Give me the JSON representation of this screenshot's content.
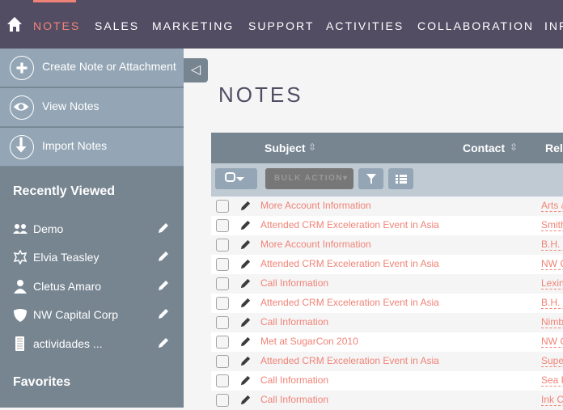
{
  "nav": {
    "tabs": [
      "NOTES",
      "SALES",
      "MARKETING",
      "SUPPORT",
      "ACTIVITIES",
      "COLLABORATION",
      "INF"
    ],
    "active": "NOTES"
  },
  "sidebar": {
    "actions": [
      {
        "label": "Create Note or Attachment",
        "icon": "plus-circle-icon"
      },
      {
        "label": "View Notes",
        "icon": "eye-icon"
      },
      {
        "label": "Import Notes",
        "icon": "download-arrow-icon"
      }
    ],
    "recently_viewed_title": "Recently Viewed",
    "recently_viewed": [
      {
        "label": "Demo",
        "icon": "users-icon"
      },
      {
        "label": "Elvia Teasley",
        "icon": "target-star-icon"
      },
      {
        "label": "Cletus Amaro",
        "icon": "user-icon"
      },
      {
        "label": "NW Capital Corp",
        "icon": "shield-icon"
      },
      {
        "label": "actividades ...",
        "icon": "document-icon"
      }
    ],
    "favorites_title": "Favorites"
  },
  "toggle": "◁",
  "page_title": "NOTES",
  "table": {
    "columns": [
      "Subject",
      "Contact",
      "Rela"
    ],
    "bulk_action": "BULK ACTION",
    "rows": [
      {
        "subject": "More Account Information",
        "related": "Arts &"
      },
      {
        "subject": "Attended CRM Exceleration Event in Asia",
        "related": "Smith"
      },
      {
        "subject": "More Account Information",
        "related": "B.H."
      },
      {
        "subject": "Attended CRM Exceleration Event in Asia",
        "related": "NW C"
      },
      {
        "subject": "Call Information",
        "related": "Lexin"
      },
      {
        "subject": "Attended CRM Exceleration Event in Asia",
        "related": "B.H."
      },
      {
        "subject": "Call Information",
        "related": "Nimb"
      },
      {
        "subject": "Met at SugarCon 2010",
        "related": "NW C"
      },
      {
        "subject": "Attended CRM Exceleration Event in Asia",
        "related": "Supe"
      },
      {
        "subject": "Call Information",
        "related": "Sea R"
      },
      {
        "subject": "Call Information",
        "related": "Ink C"
      }
    ]
  },
  "colors": {
    "nav": "#534d64",
    "accent": "#f08377",
    "sidebar": "#778591",
    "sidebar_actions": "#94a6b5"
  }
}
